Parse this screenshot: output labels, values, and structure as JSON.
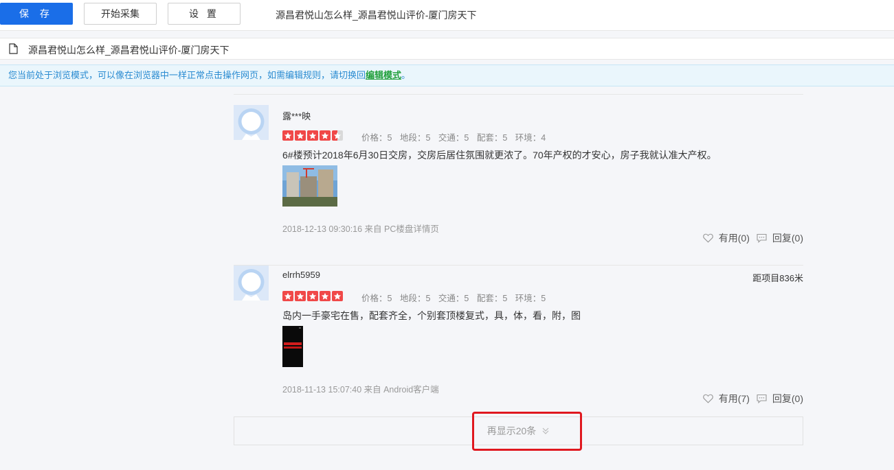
{
  "toolbar": {
    "save_label": "保 存",
    "start_label": "开始采集",
    "settings_label": "设 置",
    "page_title": "源昌君悦山怎么样_源昌君悦山评价-厦门房天下"
  },
  "urlbar": {
    "title": "源昌君悦山怎么样_源昌君悦山评价-厦门房天下",
    "icon": "document-icon"
  },
  "notice": {
    "text_before": "您当前处于浏览模式，可以像在浏览器中一样正常点击操作网页，如需编辑规则，请切换回",
    "link_text": "编辑模式",
    "text_after": "。"
  },
  "reviews": [
    {
      "username": "露***映",
      "distance": "",
      "rating": 4.5,
      "scores": [
        "价格：5",
        "地段：5",
        "交通：5",
        "配套：5",
        "环境：4"
      ],
      "text": "6#楼预计2018年6月30日交房，交房后居住氛围就更浓了。70年产权的才安心，房子我就认准大产权。",
      "meta": "2018-12-13 09:30:16  来自 PC楼盘详情页",
      "useful": "有用(0)",
      "reply": "回复(0)"
    },
    {
      "username": "elrrh5959",
      "distance": "距项目836米",
      "rating": 5,
      "scores": [
        "价格：5",
        "地段：5",
        "交通：5",
        "配套：5",
        "环境：5"
      ],
      "text": "岛内一手豪宅在售，配套齐全，个别套顶楼复式，具，体，看，附，图",
      "meta": "2018-11-13 15:07:40  来自 Android客户端",
      "useful": "有用(7)",
      "reply": "回复(0)"
    }
  ],
  "more": {
    "label": "再显示20条"
  },
  "colors": {
    "accent": "#1a6ee8",
    "star": "#f04848",
    "notice": "#2a8bd1",
    "highlight": "#e0181f"
  }
}
